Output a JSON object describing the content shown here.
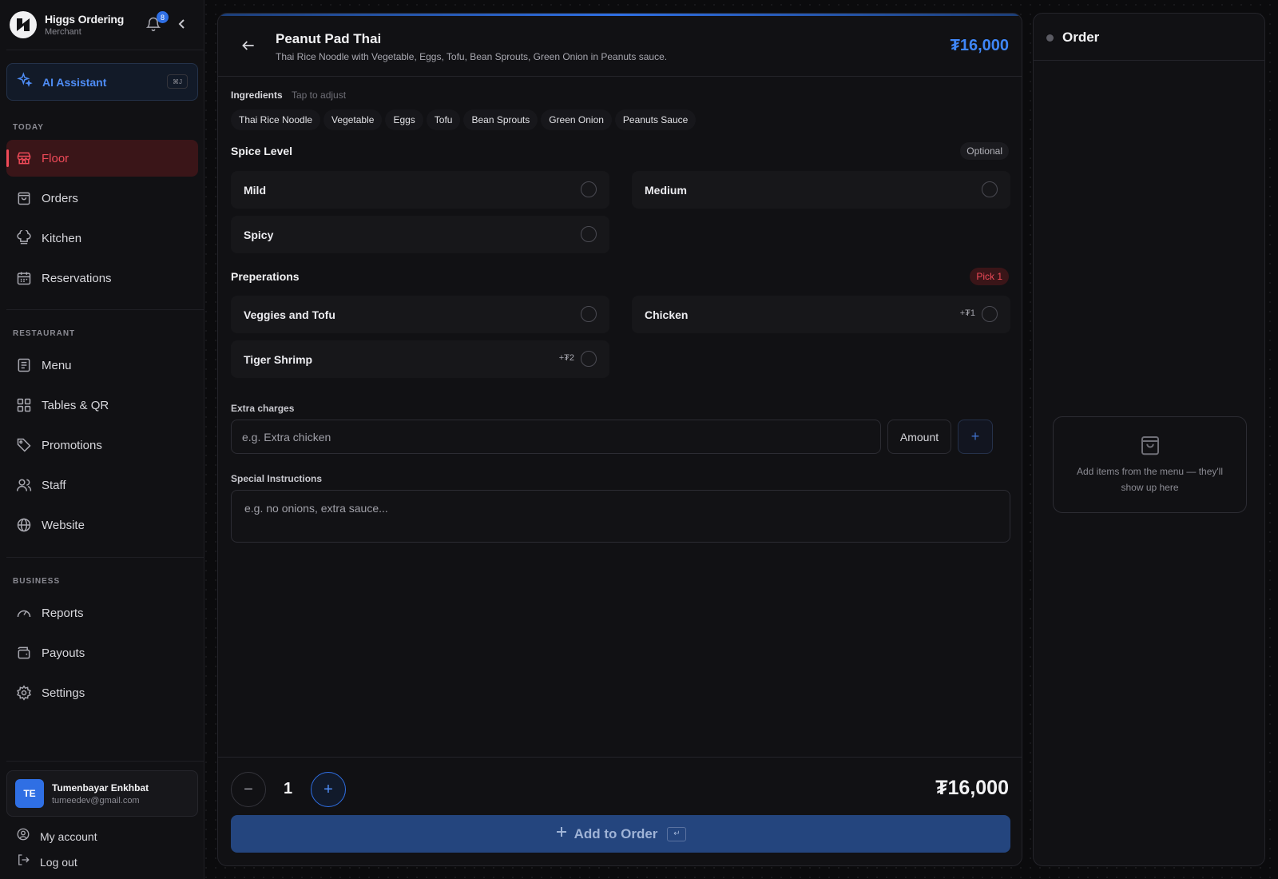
{
  "brand": {
    "title": "Higgs Ordering",
    "subtitle": "Merchant",
    "notification_count": "8"
  },
  "ai": {
    "label": "AI Assistant",
    "shortcut": "⌘J"
  },
  "sections": {
    "today": "TODAY",
    "restaurant": "RESTAURANT",
    "business": "BUSINESS"
  },
  "nav": {
    "floor": "Floor",
    "orders": "Orders",
    "kitchen": "Kitchen",
    "reservations": "Reservations",
    "menu": "Menu",
    "tables": "Tables & QR",
    "promotions": "Promotions",
    "staff": "Staff",
    "website": "Website",
    "reports": "Reports",
    "payouts": "Payouts",
    "settings": "Settings"
  },
  "user": {
    "initials": "TE",
    "name": "Tumenbayar Enkhbat",
    "email": "tumeedev@gmail.com"
  },
  "footer_links": {
    "account": "My account",
    "logout": "Log out"
  },
  "dish": {
    "name": "Peanut Pad Thai",
    "description": "Thai Rice Noodle with Vegetable, Eggs, Tofu, Bean Sprouts, Green Onion in Peanuts sauce.",
    "price": "₮16,000"
  },
  "ingredients": {
    "title": "Ingredients",
    "hint": "Tap to adjust",
    "items": [
      "Thai Rice Noodle",
      "Vegetable",
      "Eggs",
      "Tofu",
      "Bean Sprouts",
      "Green Onion",
      "Peanuts Sauce"
    ]
  },
  "spice": {
    "title": "Spice Level",
    "badge": "Optional",
    "options": [
      "Mild",
      "Medium",
      "Spicy"
    ]
  },
  "prep": {
    "title": "Preperations",
    "badge": "Pick 1",
    "options": [
      {
        "label": "Veggies and Tofu",
        "extra": ""
      },
      {
        "label": "Chicken",
        "extra": "+₮1"
      },
      {
        "label": "Tiger Shrimp",
        "extra": "+₮2"
      }
    ]
  },
  "extra": {
    "label": "Extra charges",
    "placeholder": "e.g. Extra chicken",
    "amount_label": "Amount"
  },
  "special": {
    "label": "Special Instructions",
    "placeholder": "e.g. no onions, extra sauce..."
  },
  "cart": {
    "quantity": "1",
    "total": "₮16,000",
    "add_label": "Add to Order",
    "enter_key": "↵"
  },
  "order": {
    "title": "Order",
    "empty_text": "Add items from the menu — they'll show up here"
  },
  "colors": {
    "accent": "#2f6fe4",
    "active": "#ef4a58"
  }
}
